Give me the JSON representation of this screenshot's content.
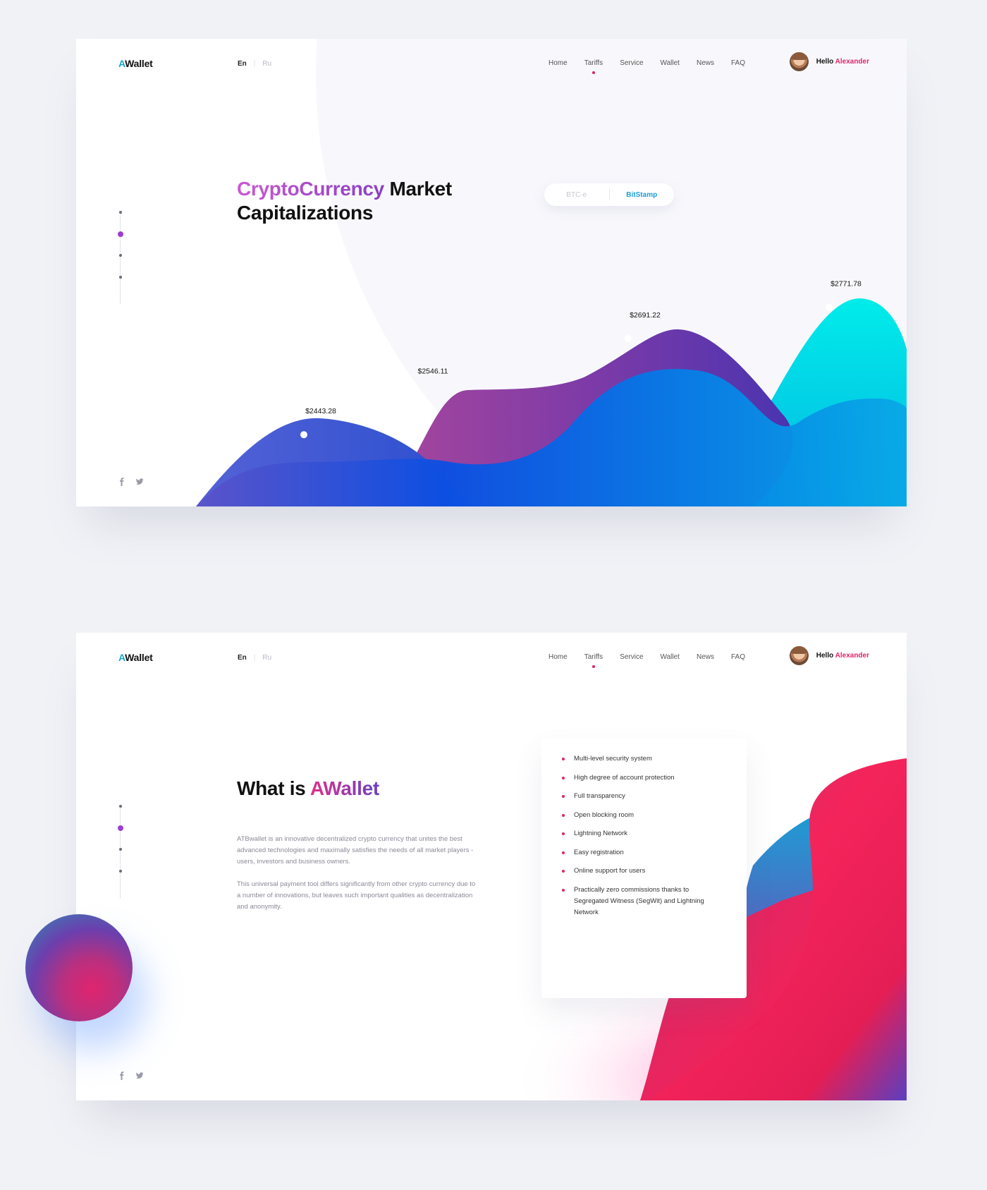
{
  "brand": {
    "logo_a": "A",
    "logo_rest": "Wallet"
  },
  "languages": {
    "active": "En",
    "other": "Ru"
  },
  "nav": {
    "items": [
      "Home",
      "Tariffs",
      "Service",
      "Wallet",
      "News",
      "FAQ"
    ],
    "active": "Tariffs"
  },
  "user": {
    "greeting": "Hello",
    "name": "Alexander"
  },
  "social": {
    "facebook_icon": "facebook-icon",
    "twitter_icon": "twitter-icon"
  },
  "colors": {
    "accent_pink": "#e0246e",
    "accent_purple": "#9a3fd1",
    "accent_blue": "#1b9ed8",
    "page_bg": "#f1f2f6"
  },
  "hero": {
    "title_highlight": "CryptoCurrency",
    "title_rest_line1": " Market",
    "title_line2": "Capitalizations",
    "exchange_options": [
      "BTC-e",
      "BitStamp"
    ],
    "exchange_selected": "BitStamp"
  },
  "chart_data": {
    "type": "area",
    "title": "",
    "xlabel": "",
    "ylabel": "",
    "points": [
      {
        "label": "$2443.28",
        "value": 2443.28
      },
      {
        "label": "$2546.11",
        "value": 2546.11
      },
      {
        "label": "$2691.22",
        "value": 2691.22
      },
      {
        "label": "$2771.78",
        "value": 2771.78
      }
    ]
  },
  "about": {
    "title_prefix": "What is ",
    "title_highlight": "AWallet",
    "paragraphs": [
      "ATBwallet is an innovative decentralized crypto currency that unites the best advanced technologies and maximally satisfies the needs of all market players - users, investors and business owners.",
      "This universal payment tool differs significantly from other crypto currency due to a number of innovations, but leaves such important qualities as decentralization and anonymity."
    ],
    "features": [
      "Multi-level security system",
      "High degree of account protection",
      "Full transparency",
      "Open blocking room",
      "Lightning Network",
      "Easy registration",
      "Online support for users",
      "Practically zero commissions thanks to Segregated Witness (SegWit) and Lightning Network"
    ]
  }
}
